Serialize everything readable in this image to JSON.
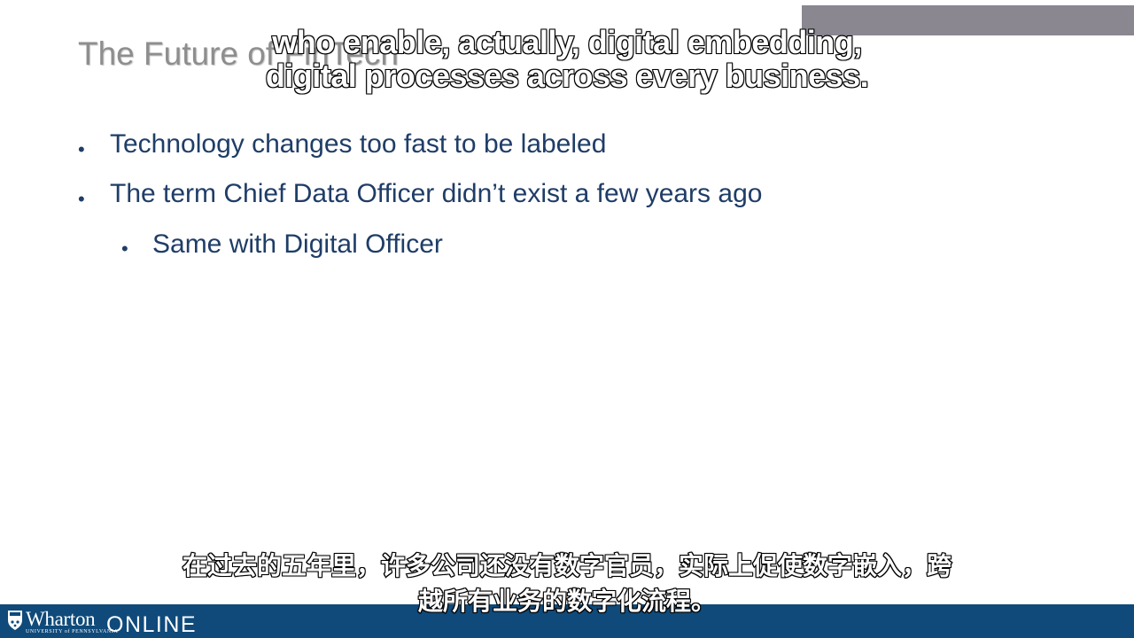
{
  "slide": {
    "title": "The Future of FinTech",
    "bullets": [
      {
        "text": "Technology changes too fast to be labeled",
        "level": 1
      },
      {
        "text": "The term Chief Data Officer didn’t exist a few years ago",
        "level": 1
      },
      {
        "text": "Same with Digital Officer",
        "level": 2
      }
    ],
    "bullet_glyph": "•"
  },
  "captions": {
    "english": [
      "who enable, actually, digital embedding,",
      "digital processes across every business."
    ],
    "chinese": [
      "在过去的五年里，许多公司还没有数字官员，实际上促使数字嵌入，跨",
      "越所有业务的数字化流程。"
    ]
  },
  "footer": {
    "brand": "Wharton",
    "university": "UNIVERSITY of PENNSYLVANIA",
    "product": "ONLINE"
  },
  "colors": {
    "footer_bg": "#0f4a7a",
    "bullet_text": "#1f3d67",
    "title_text": "#8e8e8e",
    "top_bar": "#8a8791"
  }
}
